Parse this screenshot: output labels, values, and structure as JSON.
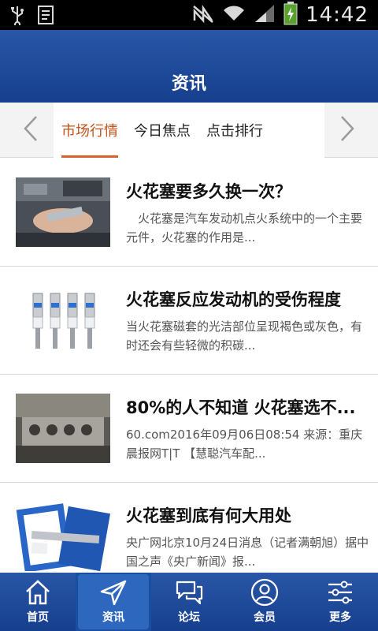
{
  "status_bar": {
    "time": "14:42"
  },
  "header": {
    "title": "资讯"
  },
  "tabs": [
    {
      "label": "市场行情",
      "active": true
    },
    {
      "label": "今日焦点",
      "active": false
    },
    {
      "label": "点击排行",
      "active": false
    }
  ],
  "news": [
    {
      "title": "火花塞要多久换一次？",
      "summary": "　火花塞是汽车发动机点火系统中的一个主要元件，火花塞的作用是...",
      "thumb": "engine-hand-icon"
    },
    {
      "title": "火花塞反应发动机的受伤程度",
      "summary": "当火花塞磁套的光洁部位呈现褐色或灰色，有时还会有些轻微的积碳...",
      "thumb": "spark-plugs-icon"
    },
    {
      "title": "80%的人不知道 火花塞选不...",
      "summary": "60.com2016年09月06日08:54 来源：重庆晨报网T|T 【慧聪汽车配...",
      "thumb": "engine-block-icon"
    },
    {
      "title": "火花塞到底有何大用处",
      "summary": "央广网北京10月24日消息（记者满朝旭）据中国之声《央广新闻》报...",
      "thumb": "spark-plug-box-icon"
    }
  ],
  "bottom_nav": [
    {
      "label": "首页",
      "icon": "home-icon",
      "active": false
    },
    {
      "label": "资讯",
      "icon": "send-arrow-icon",
      "active": true
    },
    {
      "label": "论坛",
      "icon": "chat-bubbles-icon",
      "active": false
    },
    {
      "label": "会员",
      "icon": "user-icon",
      "active": false
    },
    {
      "label": "更多",
      "icon": "sliders-icon",
      "active": false
    }
  ],
  "colors": {
    "header_blue": "#1f4c9c",
    "tab_active": "#c4501a"
  }
}
